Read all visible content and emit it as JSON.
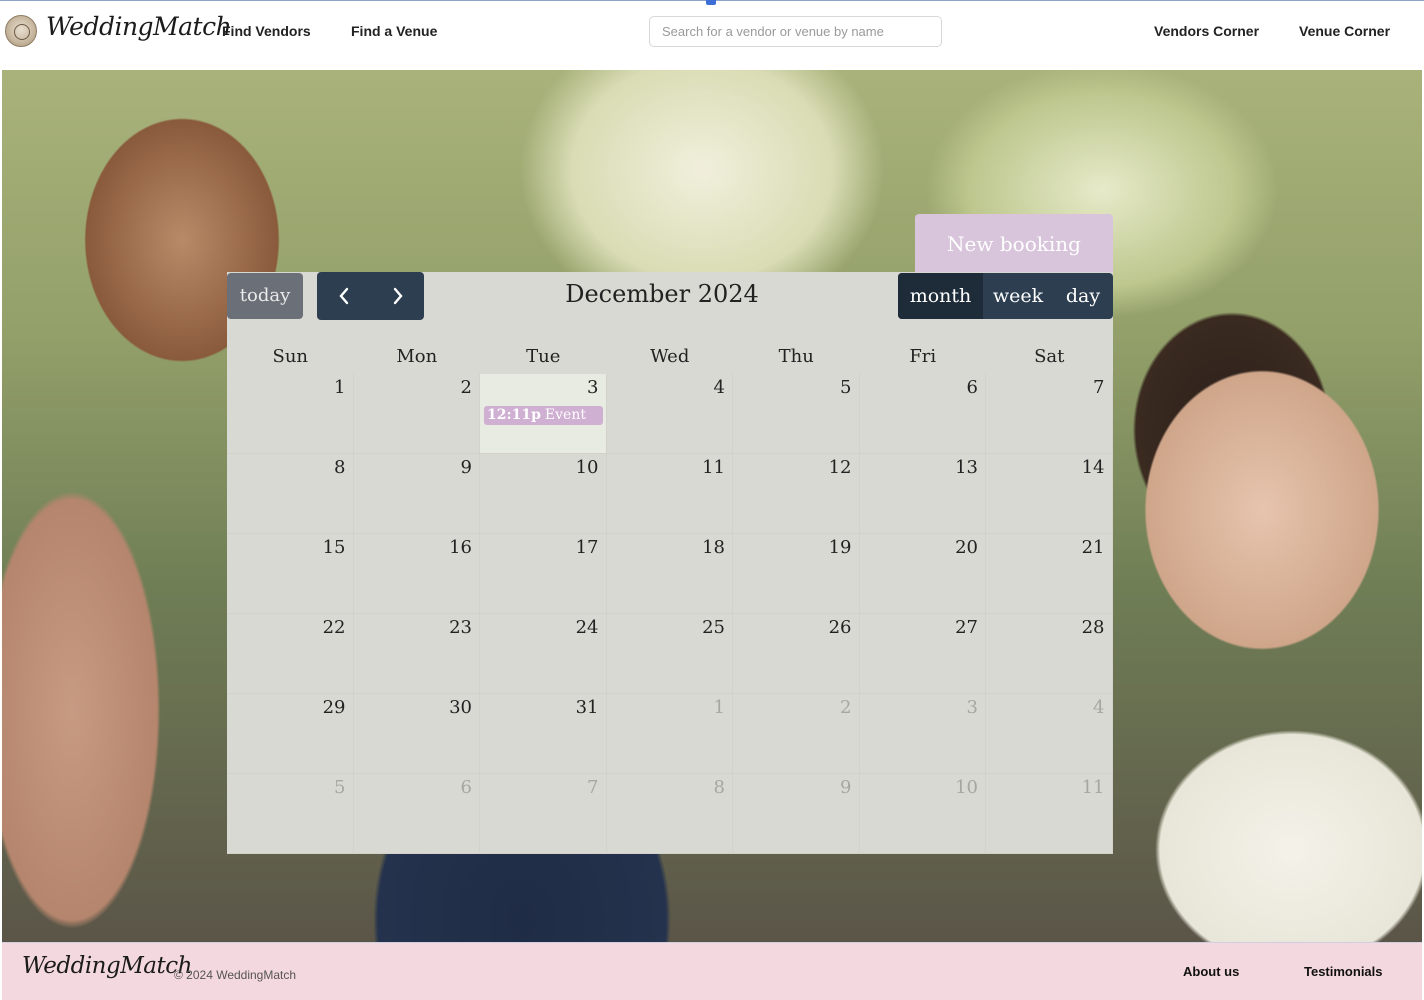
{
  "header": {
    "logo_text": "WeddingMatch",
    "nav": [
      "Find Vendors",
      "Find a Venue"
    ],
    "search_placeholder": "Search for a vendor or venue by name",
    "right_links": [
      "Vendors Corner",
      "Venue Corner"
    ]
  },
  "booking": {
    "new_booking_label": "New booking"
  },
  "calendar": {
    "today_label": "today",
    "prev_icon": "chevron-left-icon",
    "next_icon": "chevron-right-icon",
    "title": "December 2024",
    "views": [
      "month",
      "week",
      "day"
    ],
    "active_view": "month",
    "days_of_week": [
      "Sun",
      "Mon",
      "Tue",
      "Wed",
      "Thu",
      "Fri",
      "Sat"
    ],
    "weeks": [
      [
        "1",
        "2",
        "3",
        "4",
        "5",
        "6",
        "7"
      ],
      [
        "8",
        "9",
        "10",
        "11",
        "12",
        "13",
        "14"
      ],
      [
        "15",
        "16",
        "17",
        "18",
        "19",
        "20",
        "21"
      ],
      [
        "22",
        "23",
        "24",
        "25",
        "26",
        "27",
        "28"
      ],
      [
        "29",
        "30",
        "31",
        "1",
        "2",
        "3",
        "4"
      ],
      [
        "5",
        "6",
        "7",
        "8",
        "9",
        "10",
        "11"
      ]
    ],
    "today_date": "3",
    "event": {
      "time": "12:11p",
      "title": "Event",
      "date": "3"
    },
    "colors": {
      "header_dark": "#2c3e50",
      "event": "#cfafd2",
      "today_bg": "#e8ebe1",
      "cell_bg": "#d9d9d3"
    }
  },
  "footer": {
    "logo_text": "WeddingMatch",
    "copyright": "© 2024 WeddingMatch",
    "links": [
      "About us",
      "Testimonials"
    ]
  }
}
